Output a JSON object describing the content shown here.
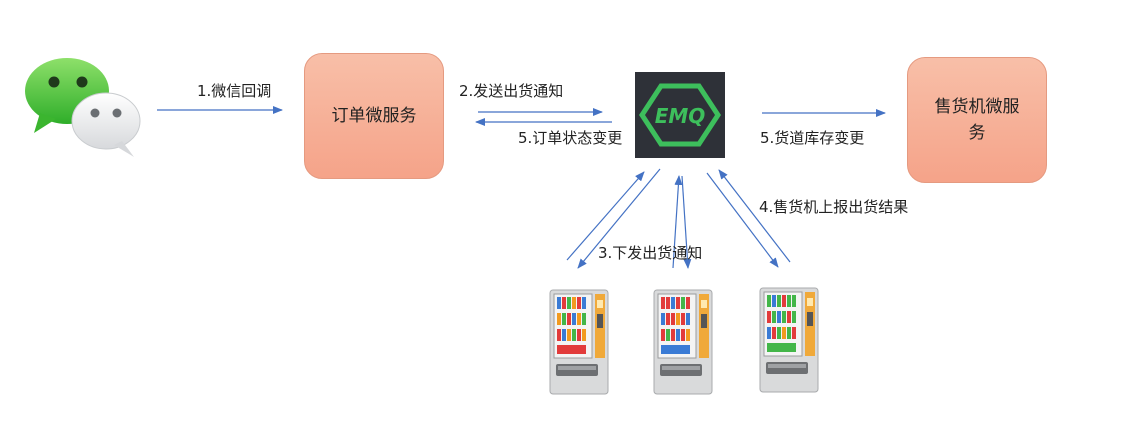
{
  "services": {
    "order": "订单微服务",
    "vending_line1": "售货机微服",
    "vending_line2": "务"
  },
  "broker": {
    "logo_text": "EMQ"
  },
  "edges": {
    "wechat_callback": "1.微信回调",
    "send_notice": "2.发送出货通知",
    "order_status_change": "5.订单状态变更",
    "channel_stock_change": "5.货道库存变更",
    "issue_notice": "3.下发出货通知",
    "report_result": "4.售货机上报出货结果"
  },
  "icons": {
    "wechat": "wechat-icon",
    "vending_machine": "vending-machine-icon"
  },
  "colors": {
    "box_fill": "#f5a389",
    "arrow": "#4472c4",
    "emq_bg": "#2e3138",
    "emq_green": "#3dbf5c",
    "wechat_green": "#46c43a"
  }
}
